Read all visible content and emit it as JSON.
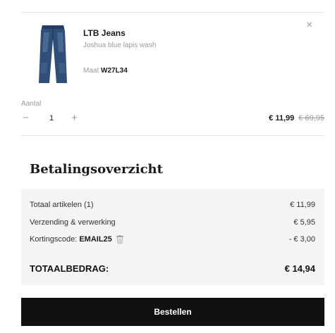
{
  "cart_item": {
    "title": "LTB Jeans",
    "subtitle": "Joshua blue lapis wash",
    "size_label": "Maat",
    "size_value": "W27L34",
    "close_icon": "×",
    "quantity_label": "Aantal",
    "quantity_minus": "−",
    "quantity_value": "1",
    "quantity_plus": "+",
    "price_current": "€ 11,99",
    "price_original": "€ 69,95",
    "thumbnail_icon": "jeans-product-image"
  },
  "summary": {
    "heading": "Betalingsoverzicht",
    "rows": [
      {
        "label": "Totaal artikelen (1)",
        "value": "€ 11,99"
      },
      {
        "label": "Verzending & verwerking",
        "value": "€ 5,95"
      },
      {
        "label_prefix": "Kortingscode:",
        "code": "EMAIL25",
        "value": "- € 3,00"
      }
    ],
    "total_label": "TOTAALBEDRAG:",
    "total_value": "€ 14,94"
  },
  "actions": {
    "order_button": "Bestellen"
  },
  "colors": {
    "button_bg": "#111111",
    "summary_bg": "#f4f4f4",
    "muted_text": "#9a9a9a"
  }
}
